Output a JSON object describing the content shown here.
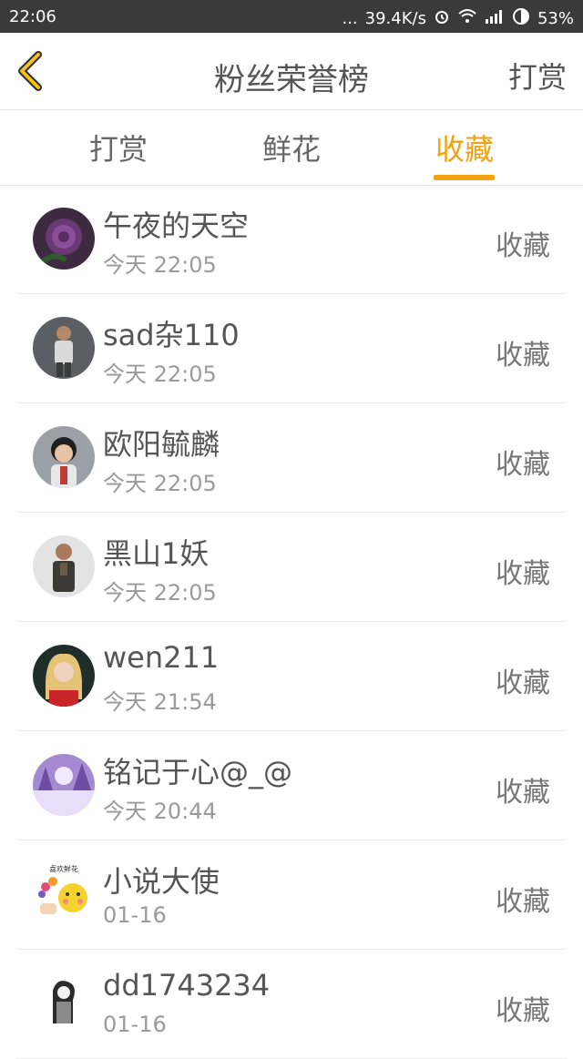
{
  "status_bar": {
    "time": "22:06",
    "dots": "...",
    "network_speed": "39.4K/s",
    "battery": "53%"
  },
  "header": {
    "title": "粉丝荣誉榜",
    "action_label": "打赏",
    "accent_color": "#f2a10f"
  },
  "tabs": [
    {
      "label": "打赏",
      "active": false
    },
    {
      "label": "鲜花",
      "active": false
    },
    {
      "label": "收藏",
      "active": true
    }
  ],
  "list": [
    {
      "name": "午夜的天空",
      "time": "今天 22:05",
      "action": "收藏"
    },
    {
      "name": "sad杂110",
      "time": "今天 22:05",
      "action": "收藏"
    },
    {
      "name": "欧阳毓麟",
      "time": "今天 22:05",
      "action": "收藏"
    },
    {
      "name": "黑山1妖",
      "time": "今天 22:05",
      "action": "收藏"
    },
    {
      "name": "wen211",
      "time": "今天 21:54",
      "action": "收藏"
    },
    {
      "name": "铭记于心@_@",
      "time": "今天 20:44",
      "action": "收藏"
    },
    {
      "name": "小说大使",
      "time": "01-16",
      "action": "收藏",
      "avatar_text": "喜欢鲜花"
    },
    {
      "name": "dd1743234",
      "time": "01-16",
      "action": "收藏"
    }
  ]
}
